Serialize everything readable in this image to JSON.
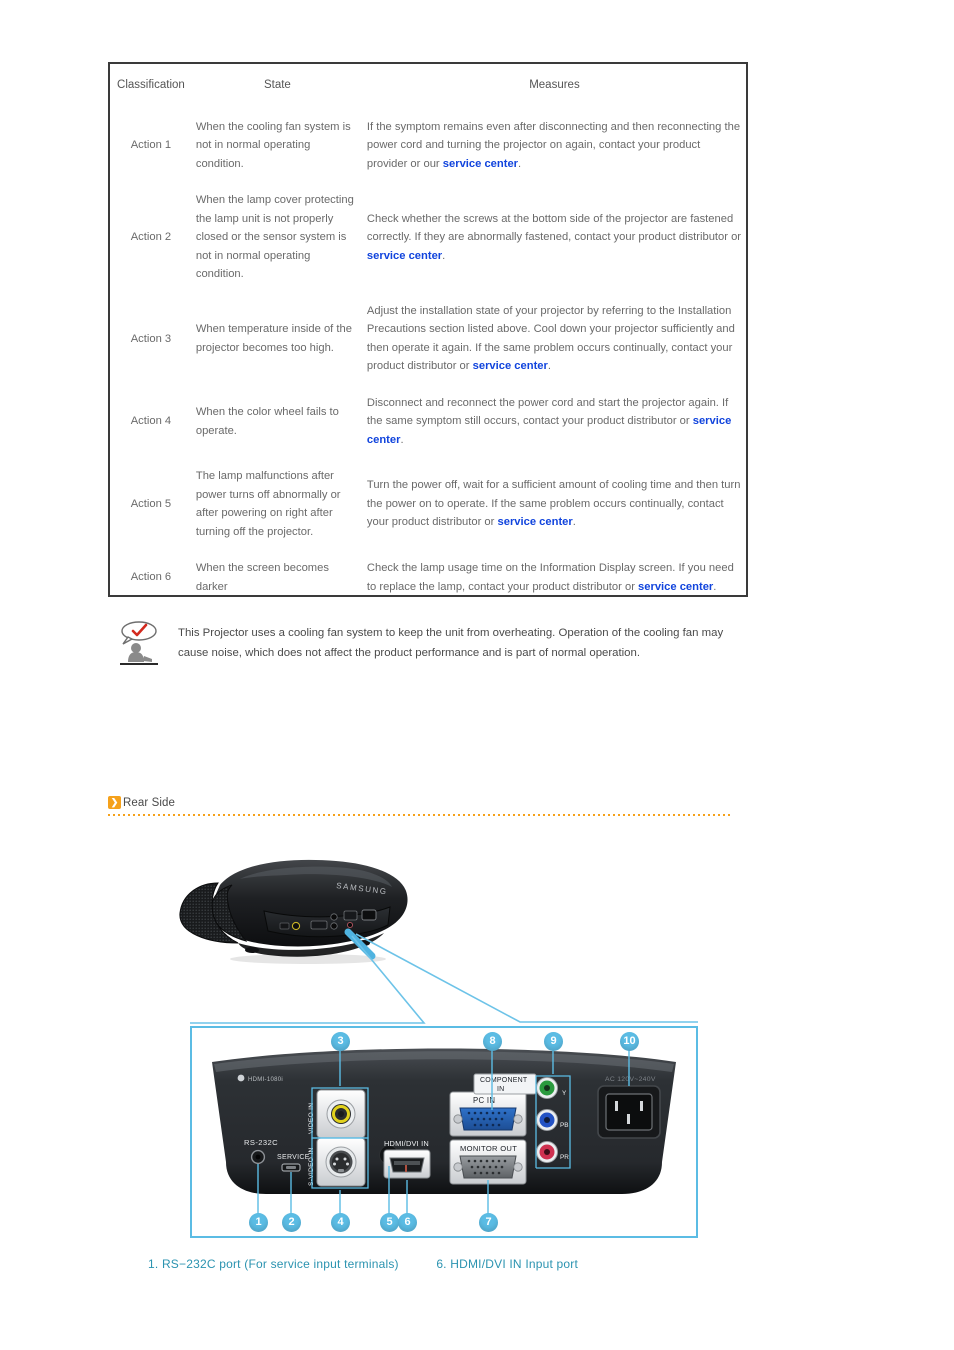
{
  "table": {
    "headers": [
      "Classification",
      "State",
      "Measures"
    ],
    "rows": [
      {
        "classification": "Action 1",
        "state": "When the cooling fan system is not in normal operating condition.",
        "measure_pre": "If the symptom remains even after disconnecting and then reconnecting the power cord and turning the projector on again, contact your product provider or our ",
        "measure_link": "service center",
        "measure_post": "."
      },
      {
        "classification": "Action 2",
        "state": "When the lamp cover protecting the lamp unit is not properly closed or the sensor system is not in normal operating condition.",
        "measure_pre": "Check whether the screws at the bottom side of the projector are fastened correctly. If they are abnormally fastened, contact your product distributor or ",
        "measure_link": "service center",
        "measure_post": "."
      },
      {
        "classification": "Action 3",
        "state": "When temperature inside of the projector becomes too high.",
        "measure_pre": "Adjust the installation state of your projector by referring to the Installation Precautions section listed above. Cool down your projector sufficiently and then operate it again. If the same problem occurs continually, contact your product distributor or ",
        "measure_link": "service center",
        "measure_post": "."
      },
      {
        "classification": "Action 4",
        "state": "When the color wheel fails to operate.",
        "measure_pre": "Disconnect and reconnect the power cord and start the projector again. If the same symptom still occurs, contact your product distributor or ",
        "measure_link": "service center",
        "measure_post": "."
      },
      {
        "classification": "Action 5",
        "state": "The lamp malfunctions after power turns off abnormally or after powering on right after turning off the projector.",
        "measure_pre": "Turn the power off, wait for a sufficient amount of cooling time and then turn the power on to operate. If the same problem occurs continually, contact your product distributor or ",
        "measure_link": "service center",
        "measure_post": "."
      },
      {
        "classification": "Action 6",
        "state": "When the screen becomes darker",
        "measure_pre": "Check the lamp usage time on the Information Display screen. If you need to replace the lamp, contact your product distributor or ",
        "measure_link": "service center",
        "measure_post": "."
      }
    ]
  },
  "note": {
    "icon": "note-person-checkmark-icon",
    "text": "This Projector uses a cooling fan system to keep the unit from overheating. Operation of the cooling fan may cause noise, which does not affect the product performance and is part of normal operation."
  },
  "section": {
    "chevron_icon": "chevron-right-icon",
    "chevron_glyph": "❯",
    "title": "Rear Side"
  },
  "projector": {
    "brand": "SAMSUNG"
  },
  "panel": {
    "model_badge": "HDMI-1080i",
    "labels": {
      "rs232c": "RS-232C",
      "service": "SERVICE",
      "video_in": "VIDEO IN",
      "svideo_in": "S-VIDEO IN",
      "hdmi": "HDMI/DVI IN",
      "pc_in": "PC IN",
      "monitor_out": "MONITOR OUT",
      "component_in": "COMPONENT\nIN",
      "component_in_l1": "COMPONENT",
      "component_in_l2": "IN",
      "ac": "AC 120V~240V",
      "comp_y": "Y",
      "comp_pb": "PB",
      "comp_pr": "PR"
    },
    "callouts": [
      "1",
      "2",
      "3",
      "4",
      "5",
      "6",
      "7",
      "8",
      "9",
      "10"
    ]
  },
  "caption": {
    "item1": "1. RS−232C port (For service input terminals)",
    "item6": "6. HDMI/DVI IN Input port"
  },
  "colors": {
    "link_blue": "#1144dd",
    "accent_orange": "#F5A11B",
    "callout_blue": "#5BBCE4",
    "caption_teal": "#2B93B0",
    "table_border": "#3a3a3a"
  }
}
